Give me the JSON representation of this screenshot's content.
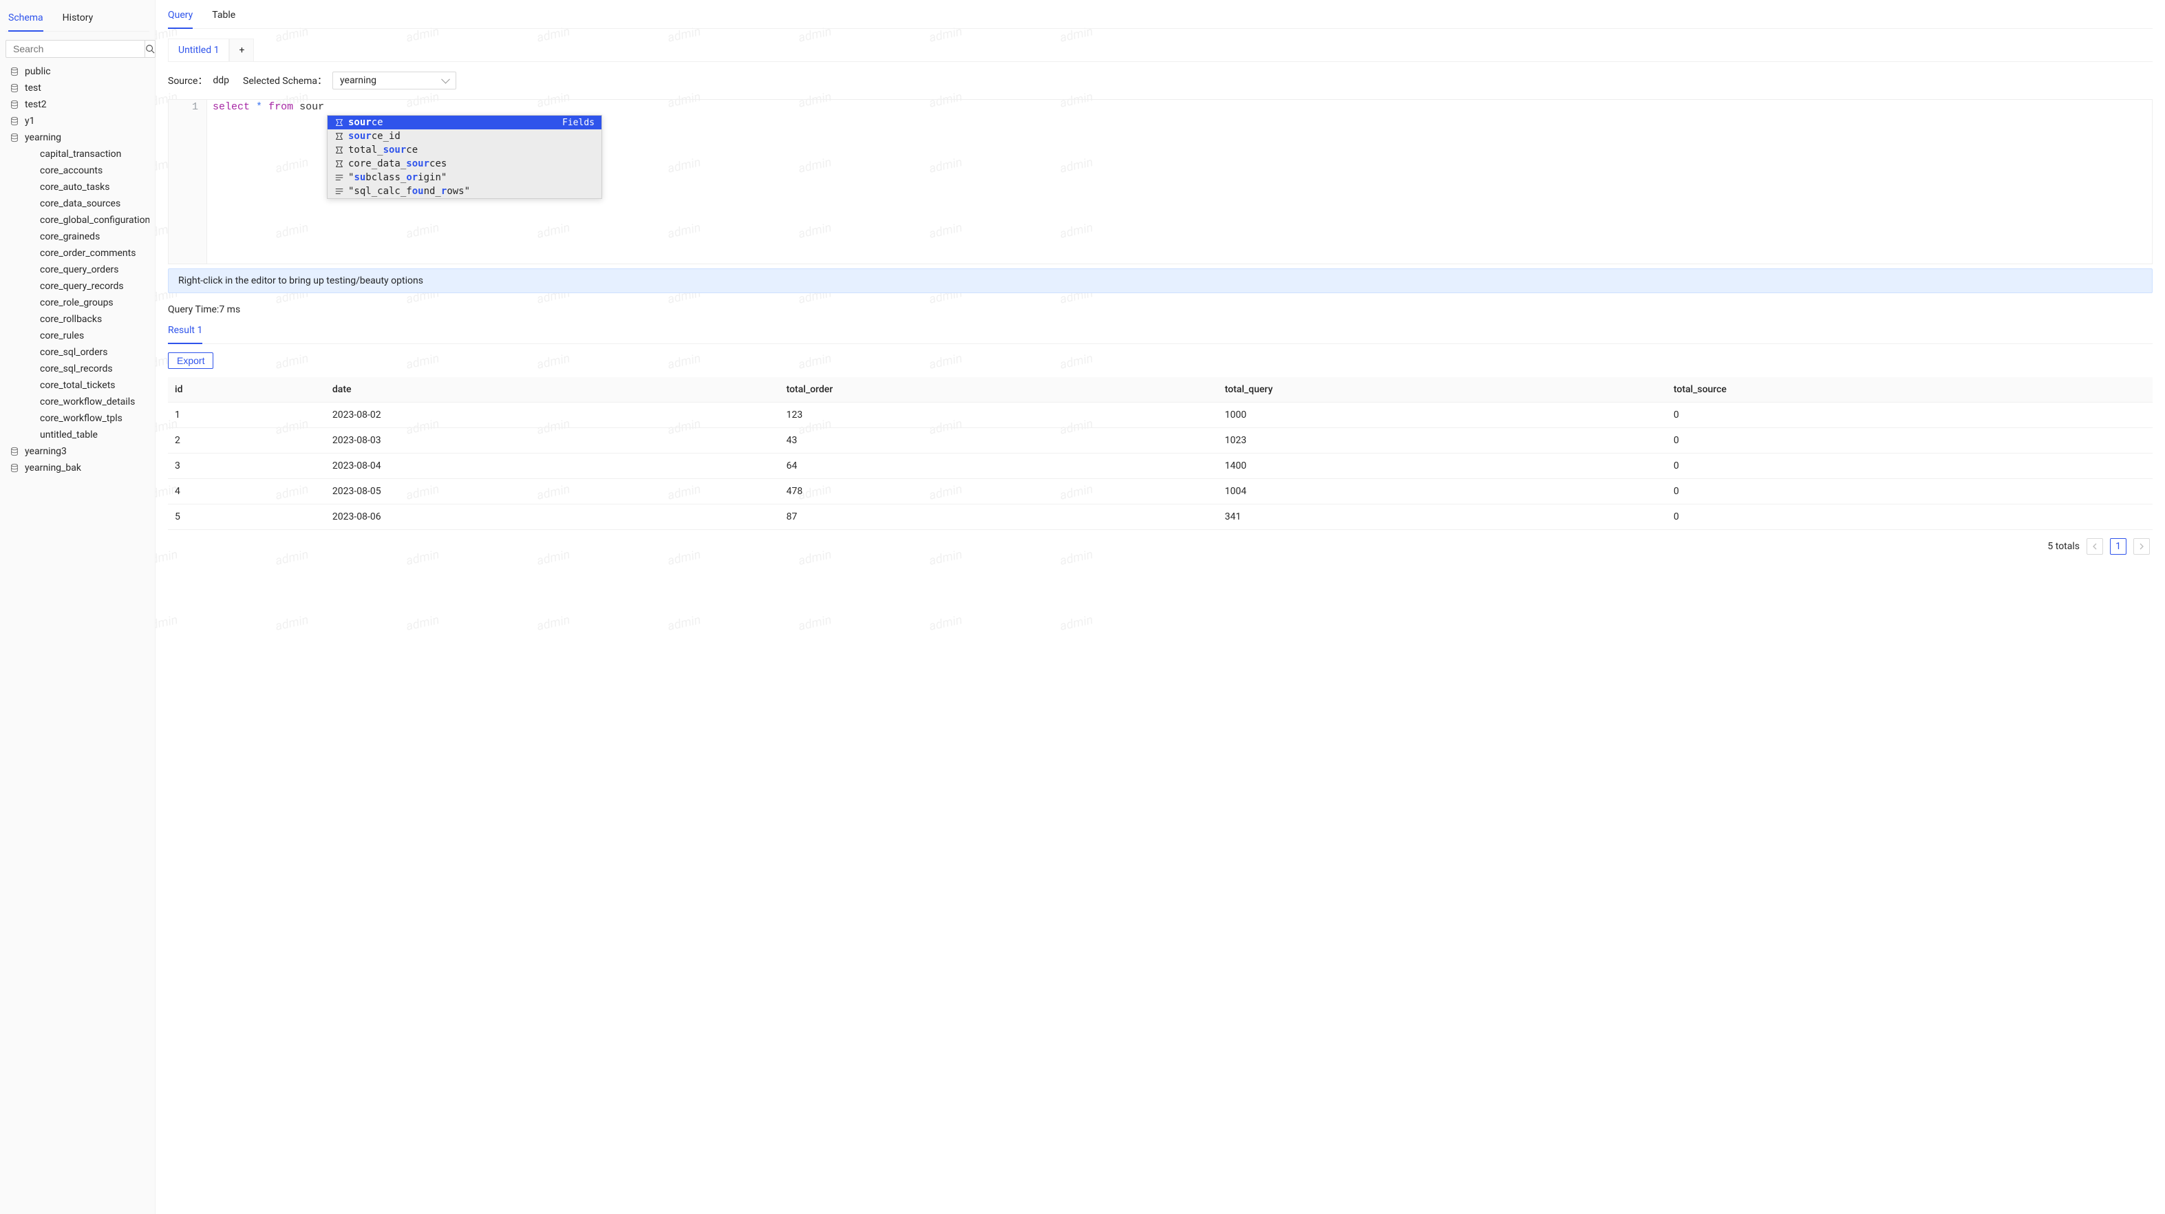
{
  "watermark": "admin",
  "sidebar": {
    "tabs": {
      "schema": "Schema",
      "history": "History"
    },
    "search_placeholder": "Search",
    "dbs": [
      "public",
      "test",
      "test2",
      "y1",
      "yearning",
      "yearning3",
      "yearning_bak"
    ],
    "expanded_db": "yearning",
    "tables": [
      "capital_transaction",
      "core_accounts",
      "core_auto_tasks",
      "core_data_sources",
      "core_global_configuration",
      "core_graineds",
      "core_order_comments",
      "core_query_orders",
      "core_query_records",
      "core_role_groups",
      "core_rollbacks",
      "core_rules",
      "core_sql_orders",
      "core_sql_records",
      "core_total_tickets",
      "core_workflow_details",
      "core_workflow_tpls",
      "untitled_table"
    ]
  },
  "main": {
    "tabs": {
      "query": "Query",
      "table": "Table"
    },
    "query_tabs": {
      "current": "Untitled 1",
      "add": "+"
    },
    "source_label": "Source：",
    "source_value": "ddp",
    "schema_label": "Selected Schema：",
    "schema_selected": "yearning",
    "editor": {
      "line_no": "1",
      "kw_select": "select",
      "op_star": "*",
      "kw_from": "from",
      "token": "sour"
    },
    "autocomplete": {
      "hint": "Fields",
      "items": [
        {
          "pre": "",
          "hl": "sour",
          "post": "ce",
          "type": "field",
          "selected": true
        },
        {
          "pre": "",
          "hl": "sour",
          "post": "ce_id",
          "type": "field"
        },
        {
          "pre": "total_",
          "hl": "sour",
          "post": "ce",
          "type": "field"
        },
        {
          "pre": "core_data_",
          "hl": "sour",
          "post": "ces",
          "type": "field"
        },
        {
          "pre": "\"",
          "hl": "su",
          "mid": "bclass_",
          "hl2": "or",
          "post": "igin\"",
          "type": "kw"
        },
        {
          "pre": "\"sql_calc_f",
          "hl": "ou",
          "mid": "nd_",
          "hl2": "r",
          "post": "ows\"",
          "type": "kw"
        }
      ]
    },
    "hint_banner": "Right-click in the editor to bring up testing/beauty options",
    "query_time_label": "Query Time:",
    "query_time_value": "7 ms",
    "result_tab": "Result 1",
    "export": "Export",
    "columns": [
      "id",
      "date",
      "total_order",
      "total_query",
      "total_source"
    ],
    "rows": [
      [
        "1",
        "2023-08-02",
        "123",
        "1000",
        "0"
      ],
      [
        "2",
        "2023-08-03",
        "43",
        "1023",
        "0"
      ],
      [
        "3",
        "2023-08-04",
        "64",
        "1400",
        "0"
      ],
      [
        "4",
        "2023-08-05",
        "478",
        "1004",
        "0"
      ],
      [
        "5",
        "2023-08-06",
        "87",
        "341",
        "0"
      ]
    ],
    "totals_label": "5 totals",
    "page": "1"
  }
}
